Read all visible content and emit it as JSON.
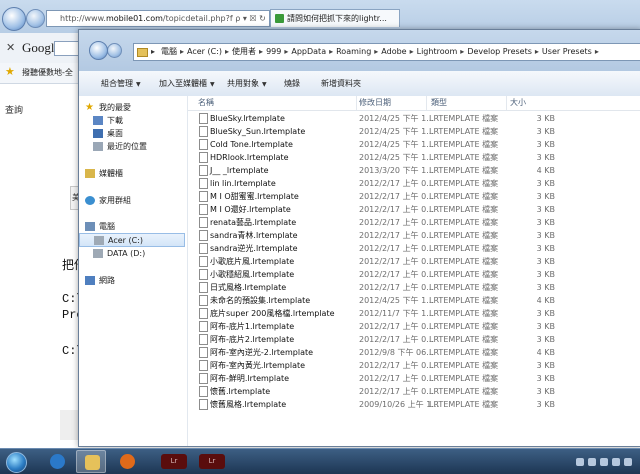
{
  "browser": {
    "url_prefix": "http://www.",
    "url_bold": "mobile01.com",
    "url_rest": "/topicdetail.php?f",
    "url_controls": "ρ ▾ ☒ ↻ ✕",
    "tab_title": "請問如何把抓下來的lightr...",
    "close_toolbar": "✕",
    "search_logo": "Google",
    "favorites_text": "撥聽優數地-全",
    "page_text_1": "查詢",
    "page_text_2": "美i",
    "page_text_3": "把他",
    "page_text_4": "C:\\",
    "page_text_5": "Pre",
    "page_text_6": "C:\\"
  },
  "explorer": {
    "breadcrumb": [
      "電腦",
      "Acer (C:)",
      "使用者",
      "999",
      "AppData",
      "Roaming",
      "Adobe",
      "Lightroom",
      "Develop Presets",
      "User Presets"
    ],
    "breadcrumb_sep": "▸",
    "toolbar": {
      "organize": "組合管理",
      "include_library": "加入至媒體櫃",
      "share": "共用對象",
      "burn": "燒錄",
      "new_folder": "新增資料夾"
    },
    "nav": {
      "favorites": "我的最愛",
      "downloads": "下載",
      "desktop": "桌面",
      "recent": "最近的位置",
      "libraries": "媒體櫃",
      "homegroup": "家用群組",
      "computer": "電腦",
      "drive_c": "Acer (C:)",
      "drive_d": "DATA (D:)",
      "network": "網路"
    },
    "columns": {
      "name": "名稱",
      "date": "修改日期",
      "type": "類型",
      "size": "大小"
    },
    "files": [
      {
        "name": "BlueSky.lrtemplate",
        "date": "2012/4/25 下午 1...",
        "type": "LRTEMPLATE 檔案",
        "size": "3 KB"
      },
      {
        "name": "BlueSky_Sun.lrtemplate",
        "date": "2012/4/25 下午 1...",
        "type": "LRTEMPLATE 檔案",
        "size": "3 KB"
      },
      {
        "name": "Cold Tone.lrtemplate",
        "date": "2012/4/25 下午 1...",
        "type": "LRTEMPLATE 檔案",
        "size": "3 KB"
      },
      {
        "name": "HDRlook.lrtemplate",
        "date": "2012/4/25 下午 1...",
        "type": "LRTEMPLATE 檔案",
        "size": "3 KB"
      },
      {
        "name": "J__ _lrtemplate",
        "date": "2013/3/20 下午 1...",
        "type": "LRTEMPLATE 檔案",
        "size": "4 KB"
      },
      {
        "name": "lin lin.lrtemplate",
        "date": "2012/2/17 上午 0...",
        "type": "LRTEMPLATE 檔案",
        "size": "3 KB"
      },
      {
        "name": "M I O甜蜜蜜.lrtemplate",
        "date": "2012/2/17 上午 0...",
        "type": "LRTEMPLATE 檔案",
        "size": "3 KB"
      },
      {
        "name": "M I O還好.lrtemplate",
        "date": "2012/2/17 上午 0...",
        "type": "LRTEMPLATE 檔案",
        "size": "3 KB"
      },
      {
        "name": "renata藝品.lrtemplate",
        "date": "2012/2/17 上午 0...",
        "type": "LRTEMPLATE 檔案",
        "size": "3 KB"
      },
      {
        "name": "sandra青林.lrtemplate",
        "date": "2012/2/17 上午 0...",
        "type": "LRTEMPLATE 檔案",
        "size": "3 KB"
      },
      {
        "name": "sandra逆光.lrtemplate",
        "date": "2012/2/17 上午 0...",
        "type": "LRTEMPLATE 檔案",
        "size": "3 KB"
      },
      {
        "name": "小歌底片風.lrtemplate",
        "date": "2012/2/17 上午 0...",
        "type": "LRTEMPLATE 檔案",
        "size": "3 KB"
      },
      {
        "name": "小歌穩紹風.lrtemplate",
        "date": "2012/2/17 上午 0...",
        "type": "LRTEMPLATE 檔案",
        "size": "3 KB"
      },
      {
        "name": "日式風格.lrtemplate",
        "date": "2012/2/17 上午 0...",
        "type": "LRTEMPLATE 檔案",
        "size": "3 KB"
      },
      {
        "name": "未命名的預設集.lrtemplate",
        "date": "2012/4/25 下午 1...",
        "type": "LRTEMPLATE 檔案",
        "size": "4 KB"
      },
      {
        "name": "底片super 200風格檔.lrtemplate",
        "date": "2012/11/7 下午 1...",
        "type": "LRTEMPLATE 檔案",
        "size": "3 KB"
      },
      {
        "name": "阿布-底片1.lrtemplate",
        "date": "2012/2/17 上午 0...",
        "type": "LRTEMPLATE 檔案",
        "size": "3 KB"
      },
      {
        "name": "阿布-底片2.lrtemplate",
        "date": "2012/2/17 上午 0...",
        "type": "LRTEMPLATE 檔案",
        "size": "3 KB"
      },
      {
        "name": "阿布-室內逆光-2.lrtemplate",
        "date": "2012/9/8 下午 06...",
        "type": "LRTEMPLATE 檔案",
        "size": "4 KB"
      },
      {
        "name": "阿布-室內黃光.lrtemplate",
        "date": "2012/2/17 上午 0...",
        "type": "LRTEMPLATE 檔案",
        "size": "3 KB"
      },
      {
        "name": "阿布-鮮明.lrtemplate",
        "date": "2012/2/17 上午 0...",
        "type": "LRTEMPLATE 檔案",
        "size": "3 KB"
      },
      {
        "name": "懷舊.lrtemplate",
        "date": "2012/2/17 上午 0...",
        "type": "LRTEMPLATE 檔案",
        "size": "3 KB"
      },
      {
        "name": "懷舊風格.lrtemplate",
        "date": "2009/10/26 上午 1...",
        "type": "LRTEMPLATE 檔案",
        "size": "3 KB"
      }
    ]
  },
  "taskbar": {
    "items": [
      "ie",
      "explorer",
      "media-player",
      "lightroom",
      "lightroom"
    ],
    "lightroom_text": "Lr"
  }
}
